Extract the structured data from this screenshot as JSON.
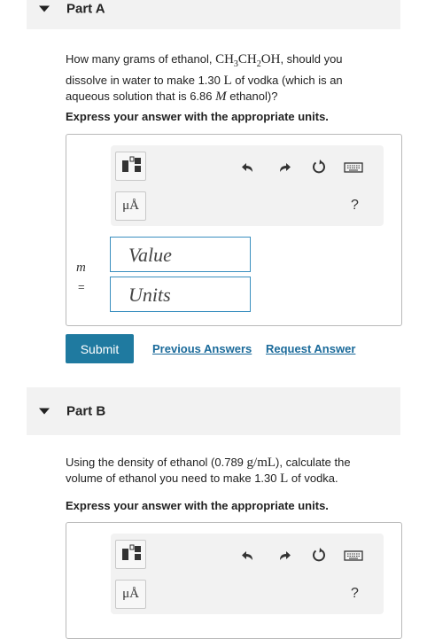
{
  "part_a": {
    "header": "Part A",
    "question_prefix": "How many grams of ethanol, ",
    "formula_ch3": "CH",
    "formula_3": "3",
    "formula_ch2": "CH",
    "formula_2": "2",
    "formula_oh": "OH",
    "question_line1_tail": ", should you",
    "question_line2": "dissolve in water to make 1.30 ",
    "unit_L": "L",
    "question_line2_tail": " of vodka (which is an",
    "question_line3_pre": "aqueous solution that is 6.86 ",
    "unit_M": "M",
    "question_line3_tail": " ethanol)?",
    "express": "Express your answer with the appropriate units.",
    "mu_label": "μÅ",
    "help": "?",
    "var_label": "m",
    "equals": "=",
    "value_placeholder": "Value",
    "units_placeholder": "Units",
    "submit": "Submit",
    "previous_answers": "Previous Answers",
    "request_answer": "Request Answer"
  },
  "part_b": {
    "header": "Part B",
    "q1_pre": "Using the density of ethanol (0.789 ",
    "density_unit": "g/mL",
    "q1_tail": "), calculate the",
    "q2_pre": "volume of ethanol you need to make 1.30 ",
    "unit_L": "L",
    "q2_tail": " of vodka.",
    "express": "Express your answer with the appropriate units.",
    "mu_label": "μÅ",
    "help": "?"
  }
}
